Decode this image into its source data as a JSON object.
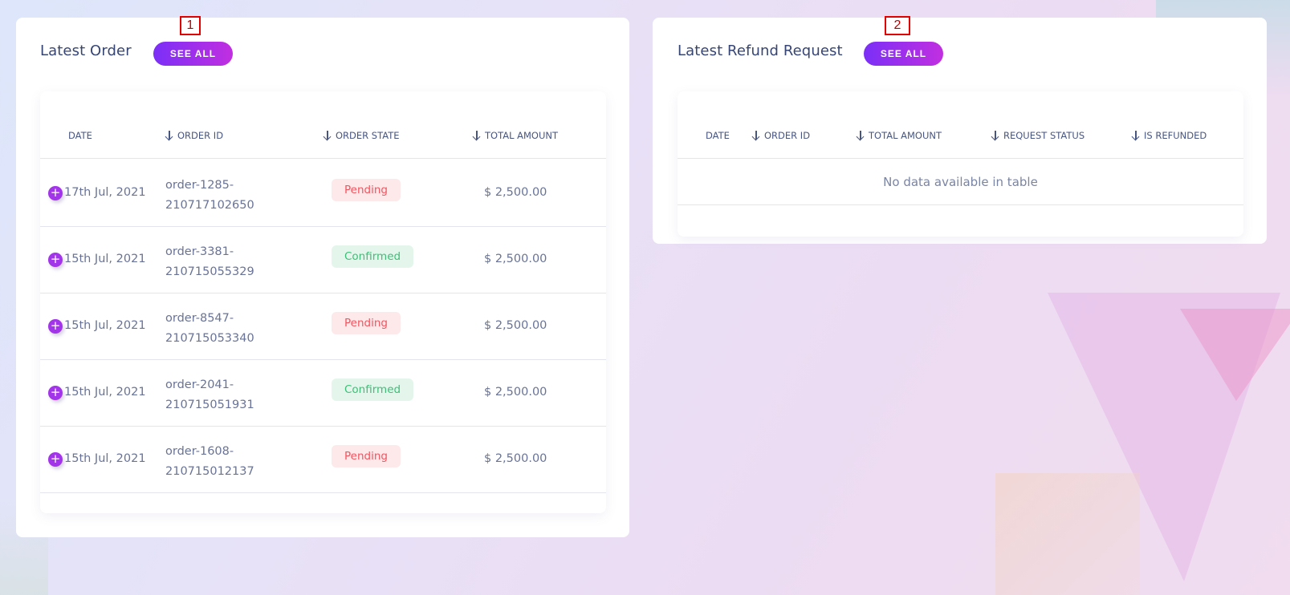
{
  "latest_order": {
    "title": "Latest Order",
    "see_all": "SEE ALL",
    "marker": "1",
    "columns": [
      "DATE",
      "ORDER ID",
      "ORDER STATE",
      "TOTAL AMOUNT"
    ],
    "rows": [
      {
        "date": "17th Jul, 2021",
        "order_id": "order-1285-210717102650",
        "state": "Pending",
        "amount": "$ 2,500.00"
      },
      {
        "date": "15th Jul, 2021",
        "order_id": "order-3381-210715055329",
        "state": "Confirmed",
        "amount": "$ 2,500.00"
      },
      {
        "date": "15th Jul, 2021",
        "order_id": "order-8547-210715053340",
        "state": "Pending",
        "amount": "$ 2,500.00"
      },
      {
        "date": "15th Jul, 2021",
        "order_id": "order-2041-210715051931",
        "state": "Confirmed",
        "amount": "$ 2,500.00"
      },
      {
        "date": "15th Jul, 2021",
        "order_id": "order-1608-210715012137",
        "state": "Pending",
        "amount": "$ 2,500.00"
      }
    ]
  },
  "latest_refund": {
    "title": "Latest Refund Request",
    "see_all": "SEE ALL",
    "marker": "2",
    "columns": [
      "DATE",
      "ORDER ID",
      "TOTAL AMOUNT",
      "REQUEST STATUS",
      "IS REFUNDED"
    ],
    "empty_text": "No data available in table"
  },
  "colors": {
    "accent_start": "#7b2ff7",
    "accent_end": "#c12fe0",
    "pending_text": "#f2555f",
    "pending_bg": "#fde8ea",
    "confirmed_text": "#3cbf76",
    "confirmed_bg": "#e4f6ec",
    "title": "#364574"
  },
  "icons": {
    "sort": "arrow-down-icon",
    "expand": "plus-circle-icon"
  }
}
